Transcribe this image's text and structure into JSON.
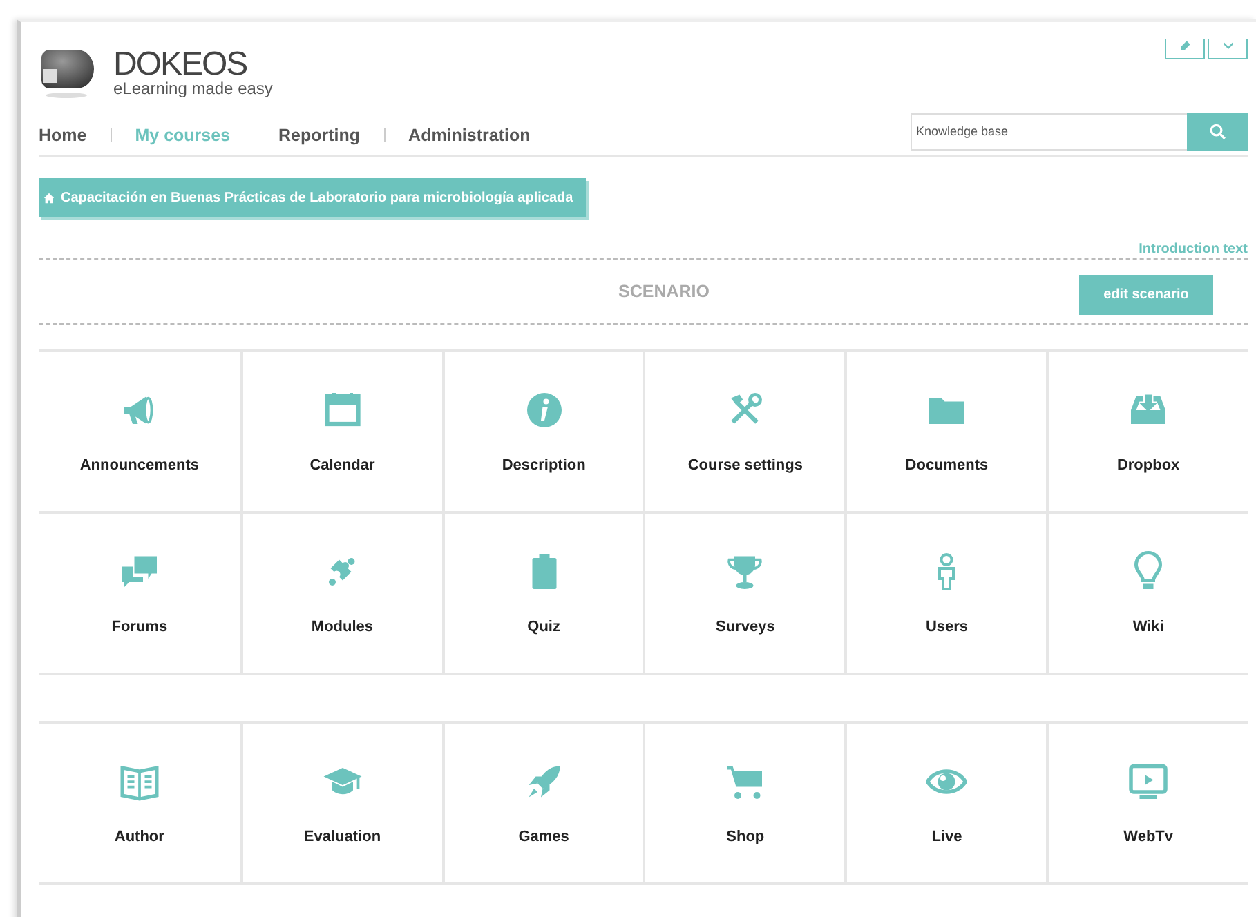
{
  "brand": {
    "name": "DOKEOS",
    "tagline": "eLearning made easy"
  },
  "nav": [
    {
      "label": "Home",
      "selected": false
    },
    {
      "label": "My courses",
      "selected": true
    },
    {
      "label": "Reporting",
      "selected": false
    },
    {
      "label": "Administration",
      "selected": false
    }
  ],
  "search": {
    "placeholder": "Knowledge base"
  },
  "course_title": "Capacitación en Buenas Prácticas de Laboratorio para microbiología aplicada",
  "intro_link": "Introduction text",
  "scenario": {
    "title": "SCENARIO",
    "button": "edit scenario"
  },
  "tool_groups": [
    {
      "tools": [
        {
          "label": "Announcements"
        },
        {
          "label": "Calendar"
        },
        {
          "label": "Description"
        },
        {
          "label": "Course settings"
        },
        {
          "label": "Documents"
        },
        {
          "label": "Dropbox"
        },
        {
          "label": "Forums"
        },
        {
          "label": "Modules"
        },
        {
          "label": "Quiz"
        },
        {
          "label": "Surveys"
        },
        {
          "label": "Users"
        },
        {
          "label": "Wiki"
        }
      ]
    },
    {
      "tools": [
        {
          "label": "Author"
        },
        {
          "label": "Evaluation"
        },
        {
          "label": "Games"
        },
        {
          "label": "Shop"
        },
        {
          "label": "Live"
        },
        {
          "label": "WebTv"
        }
      ]
    }
  ]
}
